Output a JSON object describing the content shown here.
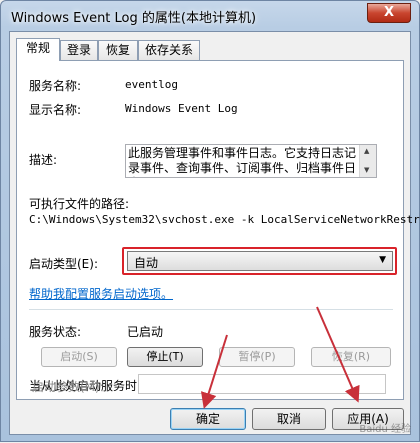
{
  "window": {
    "title": "Windows Event Log 的属性(本地计算机)",
    "close_label": "X"
  },
  "tabs": [
    {
      "label": "常规"
    },
    {
      "label": "登录"
    },
    {
      "label": "恢复"
    },
    {
      "label": "依存关系"
    }
  ],
  "general": {
    "service_name_label": "服务名称:",
    "service_name_value": "eventlog",
    "display_name_label": "显示名称:",
    "display_name_value": "Windows Event Log",
    "description_label": "描述:",
    "description_value": "此服务管理事件和事件日志。它支持日志记录事件、查询事件、订阅事件、归档事件日志以",
    "exe_path_label": "可执行文件的路径:",
    "exe_path_value": "C:\\Windows\\System32\\svchost.exe -k LocalServiceNetworkRestri",
    "startup_type_label": "启动类型(E):",
    "startup_type_value": "自动",
    "help_link": "帮助我配置服务启动选项。",
    "status_label": "服务状态:",
    "status_value": "已启动",
    "buttons": {
      "start": "启动(S)",
      "stop": "停止(T)",
      "pause": "暂停(P)",
      "resume": "恢复(R)"
    },
    "start_hint": "当从此处启动服务时，您可指定所适用的启动参数。",
    "start_params_label": "启动参数(M):",
    "start_params_value": ""
  },
  "dialog_buttons": {
    "ok": "确定",
    "cancel": "取消",
    "apply": "应用(A)"
  },
  "watermark": "Baidu 经验",
  "colors": {
    "highlight_box": "#d9232a",
    "link": "#0066cc",
    "arrow": "#c8303a"
  }
}
